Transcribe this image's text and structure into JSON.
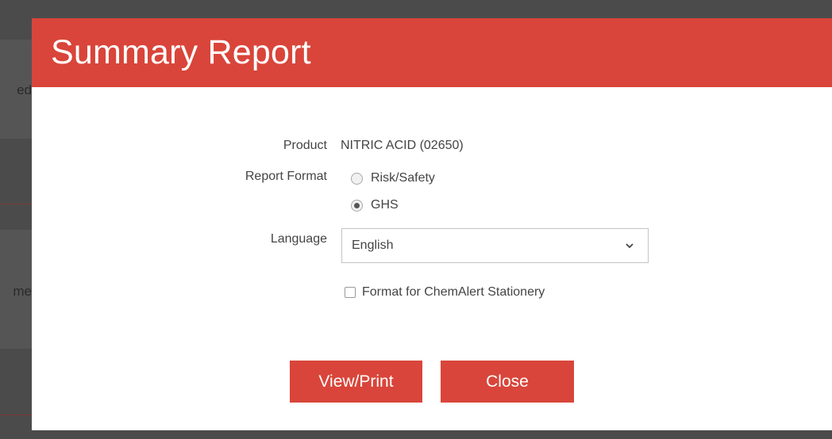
{
  "background": {
    "fragments": [
      "ed",
      "me"
    ]
  },
  "modal": {
    "title": "Summary Report",
    "accent_color": "#d9453a",
    "product_label": "Product",
    "product_value": "NITRIC ACID (02650)",
    "report_format_label": "Report Format",
    "report_format_options": [
      {
        "label": "Risk/Safety",
        "selected": false
      },
      {
        "label": "GHS",
        "selected": true
      }
    ],
    "language_label": "Language",
    "language_value": "English",
    "stationery_checkbox_label": "Format for ChemAlert Stationery",
    "stationery_checked": false,
    "view_print_label": "View/Print",
    "close_label": "Close"
  }
}
